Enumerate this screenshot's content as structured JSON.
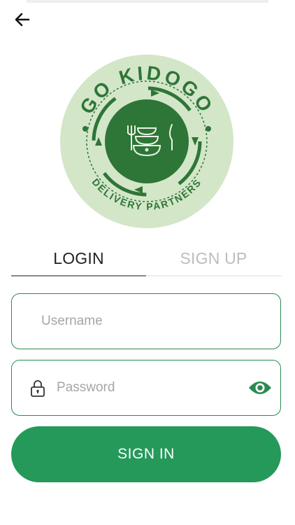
{
  "header": {
    "back_icon": "arrow-left-icon"
  },
  "logo": {
    "line1": "GO KIDOGO",
    "line2": "DELIVERY PARTNERS"
  },
  "tabs": [
    {
      "label": "LOGIN",
      "active": true
    },
    {
      "label": "SIGN UP",
      "active": false
    }
  ],
  "form": {
    "username": {
      "placeholder": "Username",
      "value": ""
    },
    "password": {
      "placeholder": "Password",
      "value": "",
      "icon": "lock-icon",
      "toggle_icon": "eye-icon"
    },
    "submit_label": "SIGN IN"
  },
  "colors": {
    "accent": "#25995a",
    "border": "#2a8a52",
    "logo_light": "#d3e6c8",
    "logo_dark": "#2e7538"
  }
}
